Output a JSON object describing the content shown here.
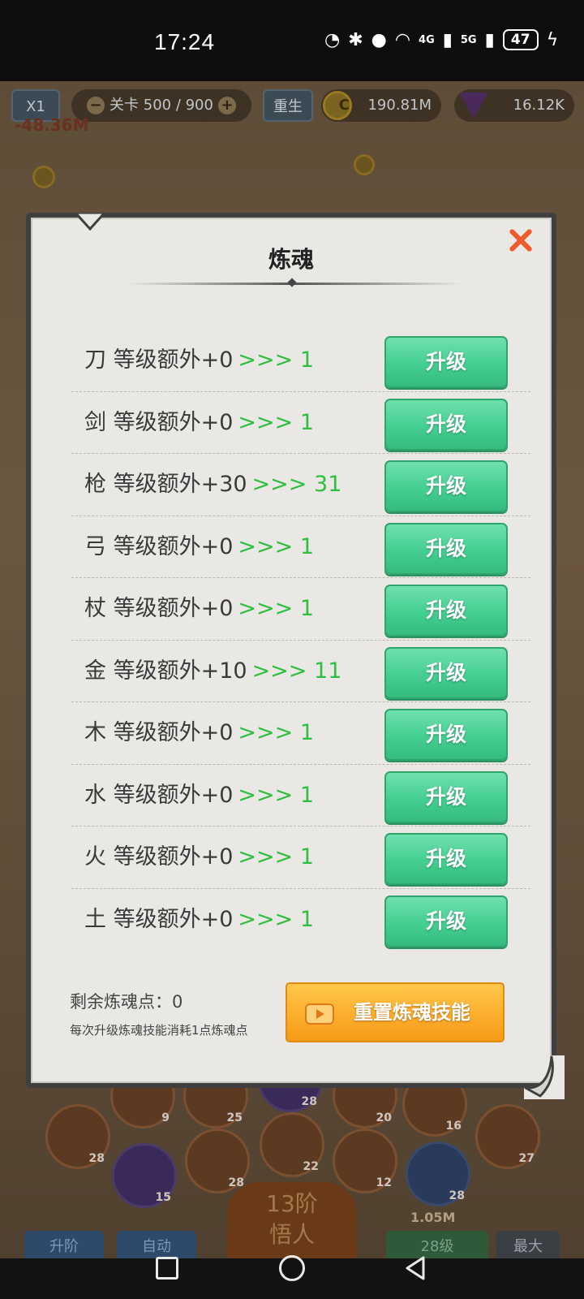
{
  "status_bar": {
    "time": "17:24",
    "signal_4g": "4G",
    "signal_5g": "5G",
    "battery": "47"
  },
  "hud": {
    "speed": "X1",
    "stage": "关卡 500 / 900",
    "reborn": "重生",
    "gold": "190.81M",
    "gems": "16.12K",
    "damage_float": "-48.36M"
  },
  "dialog": {
    "title": "炼魂",
    "rows": [
      {
        "label": "刀 等级额外+0",
        "arrow": ">>> 1",
        "button": "升级"
      },
      {
        "label": "剑 等级额外+0",
        "arrow": ">>> 1",
        "button": "升级"
      },
      {
        "label": "枪 等级额外+30",
        "arrow": ">>> 31",
        "button": "升级"
      },
      {
        "label": "弓 等级额外+0",
        "arrow": ">>> 1",
        "button": "升级"
      },
      {
        "label": "杖 等级额外+0",
        "arrow": ">>> 1",
        "button": "升级"
      },
      {
        "label": "金 等级额外+10",
        "arrow": ">>> 11",
        "button": "升级"
      },
      {
        "label": "木 等级额外+0",
        "arrow": ">>> 1",
        "button": "升级"
      },
      {
        "label": "水 等级额外+0",
        "arrow": ">>> 1",
        "button": "升级"
      },
      {
        "label": "火 等级额外+0",
        "arrow": ">>> 1",
        "button": "升级"
      },
      {
        "label": "土 等级额外+0",
        "arrow": ">>> 1",
        "button": "升级"
      }
    ],
    "remaining_points": "剩余炼魂点：0",
    "hint": "每次升级炼魂技能消耗1点炼魂点",
    "reset_button": "重置炼魂技能"
  },
  "bottom": {
    "ascend_button": "升阶",
    "auto_button": "自动",
    "stage_badge_line1": "13阶",
    "stage_badge_line2": "悟人",
    "level_value": "28级",
    "max_button": "最大",
    "cost": "1.05M",
    "zodiac_levels": [
      "9",
      "25",
      "28",
      "20",
      "16",
      "28",
      "15",
      "28",
      "22",
      "12",
      "28",
      "27"
    ]
  },
  "colors": {
    "upgrade_button": "#43cf90",
    "reset_button": "#fdb030",
    "close_icon": "#ee5a2a",
    "arrow_text": "#2fbf3f"
  },
  "icons": [
    "close-icon",
    "video-icon",
    "coin-icon",
    "gem-icon",
    "bluetooth-icon",
    "location-icon",
    "wifi-icon"
  ]
}
